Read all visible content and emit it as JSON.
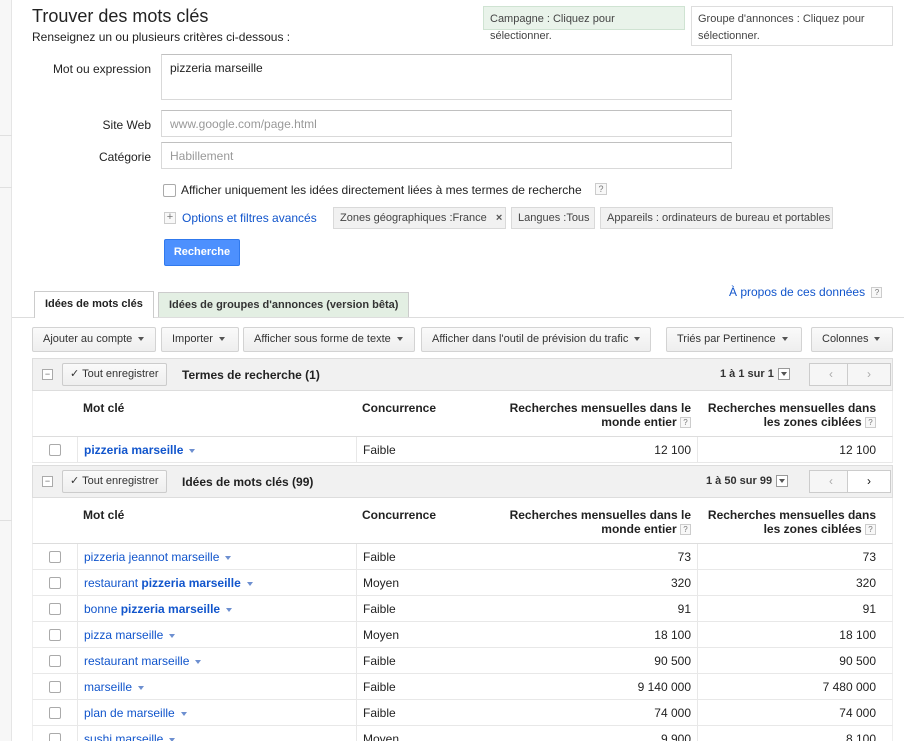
{
  "header": {
    "title": "Trouver des mots clés",
    "subtitle": "Renseignez un ou plusieurs critères ci-dessous :",
    "campaign": "Campagne : Cliquez pour sélectionner.",
    "adgroup": "Groupe d'annonces : Cliquez pour sélectionner."
  },
  "form": {
    "keyword_label": "Mot ou expression",
    "keyword_value": "pizzeria marseille",
    "website_label": "Site Web",
    "website_placeholder": "www.google.com/page.html",
    "category_label": "Catégorie",
    "category_placeholder": "Habillement",
    "only_ideas_label": "Afficher uniquement les idées directement liées à mes termes de recherche",
    "advanced_link": "Options et filtres avancés",
    "chip_geo": "Zones géographiques :France",
    "chip_lang": "Langues :Tous",
    "chip_devices": "Appareils : ordinateurs de bureau et portables",
    "search_button": "Recherche",
    "help_mark": "?",
    "plus_mark": "+",
    "close_mark": "×"
  },
  "tabs": {
    "keyword_ideas": "Idées de mots clés",
    "adgroup_ideas": "Idées de groupes d'annonces (version bêta)"
  },
  "about_link": "À propos de ces données",
  "toolbar": {
    "add_account": "Ajouter au compte",
    "import": "Importer",
    "text_view": "Afficher sous forme de texte",
    "traffic_tool": "Afficher dans l'outil de prévision du trafic",
    "sort": "Triés par Pertinence",
    "columns": "Colonnes"
  },
  "columns": {
    "keyword": "Mot clé",
    "competition": "Concurrence",
    "global_line1": "Recherches mensuelles dans le",
    "global_line2": "monde entier",
    "local_line1": "Recherches mensuelles dans",
    "local_line2": "les zones ciblées"
  },
  "search_terms": {
    "save_all": "Tout enregistrer",
    "title": "Termes de recherche (1)",
    "pager_range": "1 à 1",
    "pager_total": "sur 1",
    "prev": "‹",
    "next": "›",
    "rows": [
      {
        "pre": "",
        "bold": "pizzeria marseille",
        "post": "",
        "competition": "Faible",
        "global": "12 100",
        "local": "12 100"
      }
    ]
  },
  "keyword_ideas": {
    "save_all": "Tout enregistrer",
    "title": "Idées de mots clés (99)",
    "pager_range": "1 à 50",
    "pager_total": "sur 99",
    "prev": "‹",
    "next": "›",
    "rows": [
      {
        "pre": "pizzeria jeannot marseille",
        "bold": "",
        "post": "",
        "competition": "Faible",
        "global": "73",
        "local": "73"
      },
      {
        "pre": "restaurant ",
        "bold": "pizzeria marseille",
        "post": "",
        "competition": "Moyen",
        "global": "320",
        "local": "320"
      },
      {
        "pre": "bonne ",
        "bold": "pizzeria marseille",
        "post": "",
        "competition": "Faible",
        "global": "91",
        "local": "91"
      },
      {
        "pre": "pizza marseille",
        "bold": "",
        "post": "",
        "competition": "Moyen",
        "global": "18 100",
        "local": "18 100"
      },
      {
        "pre": "restaurant marseille",
        "bold": "",
        "post": "",
        "competition": "Faible",
        "global": "90 500",
        "local": "90 500"
      },
      {
        "pre": "marseille",
        "bold": "",
        "post": "",
        "competition": "Faible",
        "global": "9 140 000",
        "local": "7 480 000"
      },
      {
        "pre": "plan de marseille",
        "bold": "",
        "post": "",
        "competition": "Faible",
        "global": "74 000",
        "local": "74 000"
      },
      {
        "pre": "sushi marseille",
        "bold": "",
        "post": "",
        "competition": "Moyen",
        "global": "9 900",
        "local": "8 100"
      }
    ]
  }
}
